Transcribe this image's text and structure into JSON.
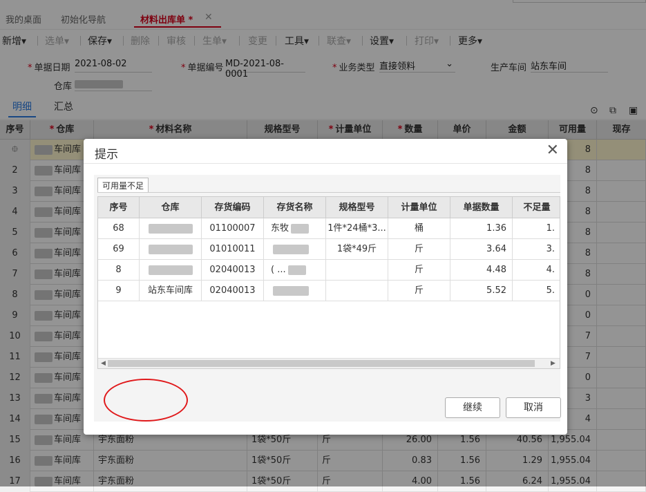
{
  "tabs": [
    {
      "label": "我的桌面"
    },
    {
      "label": "初始化导航"
    },
    {
      "label": "材料出库单 *"
    }
  ],
  "toolbar": {
    "items": [
      {
        "label": "新增▾"
      },
      {
        "label": "选单▾"
      },
      {
        "label": "保存▾"
      },
      {
        "label": "删除"
      },
      {
        "label": "审核"
      },
      {
        "label": "生单▾"
      },
      {
        "label": "变更"
      },
      {
        "label": "工具▾"
      },
      {
        "label": "联查▾"
      },
      {
        "label": "设置▾"
      },
      {
        "label": "打印▾"
      },
      {
        "label": "更多▾"
      }
    ]
  },
  "form": {
    "date_label": "单据日期",
    "date_value": "2021-08-02",
    "code_label": "单据编号",
    "code_value": "MD-2021-08-0001",
    "biz_type_label": "业务类型",
    "biz_type_value": "直接领料",
    "workshop_label": "生产车间",
    "workshop_value": "站东车间",
    "warehouse_label": "仓库"
  },
  "subtabs": [
    {
      "label": "明细"
    },
    {
      "label": "汇总"
    }
  ],
  "grid": {
    "headers": [
      "序号",
      "仓库",
      "材料名称",
      "规格型号",
      "计量单位",
      "数量",
      "单价",
      "金额",
      "可用量",
      "现存"
    ],
    "rows": [
      {
        "no": "",
        "warehouse": "车间库",
        "available": "8"
      },
      {
        "no": "2",
        "warehouse": "车间库",
        "available": "8"
      },
      {
        "no": "3",
        "warehouse": "车间库",
        "available": "8"
      },
      {
        "no": "4",
        "warehouse": "车间库",
        "available": "8"
      },
      {
        "no": "5",
        "warehouse": "车间库",
        "available": "8"
      },
      {
        "no": "6",
        "warehouse": "车间库",
        "available": "8"
      },
      {
        "no": "7",
        "warehouse": "车间库",
        "available": "8"
      },
      {
        "no": "8",
        "warehouse": "车间库",
        "available": "0"
      },
      {
        "no": "9",
        "warehouse": "车间库",
        "available": "0"
      },
      {
        "no": "10",
        "warehouse": "车间库",
        "available": "7"
      },
      {
        "no": "11",
        "warehouse": "车间库",
        "available": "7"
      },
      {
        "no": "12",
        "warehouse": "车间库",
        "available": "0"
      },
      {
        "no": "13",
        "warehouse": "车间库",
        "available": "3"
      },
      {
        "no": "14",
        "warehouse": "车间库",
        "available": "4"
      },
      {
        "no": "15",
        "warehouse": "车间库",
        "name": "宇东面粉",
        "spec": "1袋*50斤",
        "unit": "斤",
        "qty": "26.00",
        "price": "1.56",
        "amount": "40.56",
        "available": "1,955.04"
      },
      {
        "no": "16",
        "warehouse": "车间库",
        "name": "宇东面粉",
        "spec": "1袋*50斤",
        "unit": "斤",
        "qty": "0.83",
        "price": "1.56",
        "amount": "1.29",
        "available": "1,955.04"
      },
      {
        "no": "17",
        "warehouse": "车间库",
        "name": "宇东面粉",
        "spec": "1袋*50斤",
        "unit": "斤",
        "qty": "4.00",
        "price": "1.56",
        "amount": "6.24",
        "available": "1,955.04"
      }
    ]
  },
  "modal": {
    "title": "提示",
    "tab_label": "可用量不足",
    "headers": [
      "序号",
      "仓库",
      "存货编码",
      "存货名称",
      "规格型号",
      "计量单位",
      "单据数量",
      "不足量"
    ],
    "rows": [
      {
        "no": "68",
        "code": "01100007",
        "name": "东牧",
        "spec": "1件*24桶*3...",
        "unit": "桶",
        "qty": "1.36",
        "short": "1."
      },
      {
        "no": "69",
        "code": "01010011",
        "name": "",
        "spec": "1袋*49斤",
        "unit": "斤",
        "qty": "3.64",
        "short": "3."
      },
      {
        "no": "8",
        "code": "02040013",
        "name": "( ...",
        "spec": "",
        "unit": "斤",
        "qty": "4.48",
        "short": "4."
      },
      {
        "no": "9",
        "code": "02040013",
        "name": "",
        "spec": "",
        "unit": "斤",
        "qty": "5.52",
        "short": "5."
      }
    ],
    "row9_warehouse": "站东车间库",
    "continue_label": "继续",
    "cancel_label": "取消"
  },
  "colors": {
    "accent": "#d9001b",
    "link": "#2a7ae2",
    "annotation": "#e0191b"
  }
}
